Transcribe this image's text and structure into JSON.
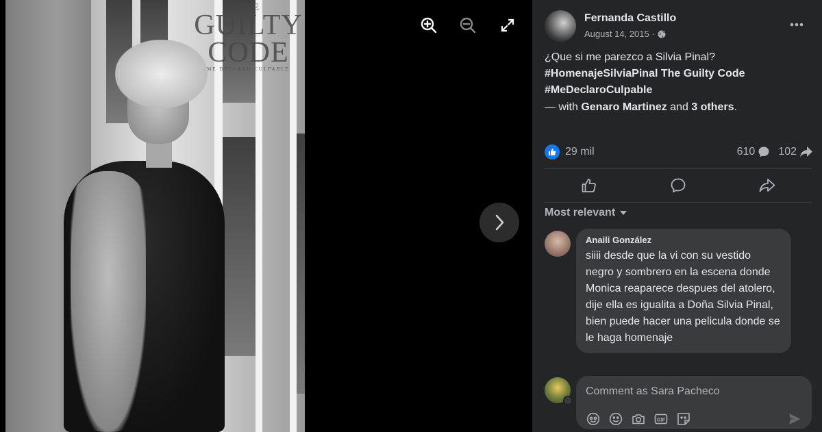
{
  "photo": {
    "magazine_the": "THE",
    "magazine_name": "GUILTY CODE",
    "magazine_sub": "ME DECLARO CULPABLE"
  },
  "viewer": {
    "zoom_in_icon": "zoom-in-icon",
    "zoom_out_icon": "zoom-out-icon",
    "fullscreen_icon": "expand-icon",
    "next_icon": "chevron-right-icon"
  },
  "post": {
    "author": "Fernanda Castillo",
    "date": "August 14, 2015",
    "separator": "·",
    "audience_icon": "globe-icon",
    "text_line1": "¿Que si me parezco a Silvia Pinal?",
    "text_line2": "#HomenajeSilviaPinal The Guilty Code",
    "text_line3": "#MeDeclaroCulpable",
    "with_prefix": "— with",
    "with_person": "Genaro Martinez",
    "with_and": "and",
    "with_others": "3 others",
    "with_suffix": ".",
    "reaction_count": "29 mil",
    "comment_count": "610",
    "share_count": "102"
  },
  "sort": {
    "label": "Most relevant"
  },
  "comments": [
    {
      "author": "Anaili González",
      "text": "siiii desde que la vi con su vestido negro y sombrero en la escena donde Monica reaparece despues del atolero, dije ella es igualita a Doña Silvia Pinal, bien puede hacer una pelicula donde se le haga homenaje"
    }
  ],
  "composer": {
    "placeholder": "Comment as Sara Pacheco"
  },
  "colors": {
    "panel_bg": "#242526",
    "bubble_bg": "#3a3b3c",
    "accent_blue": "#1877f2",
    "secondary_text": "#b0b3b8"
  }
}
